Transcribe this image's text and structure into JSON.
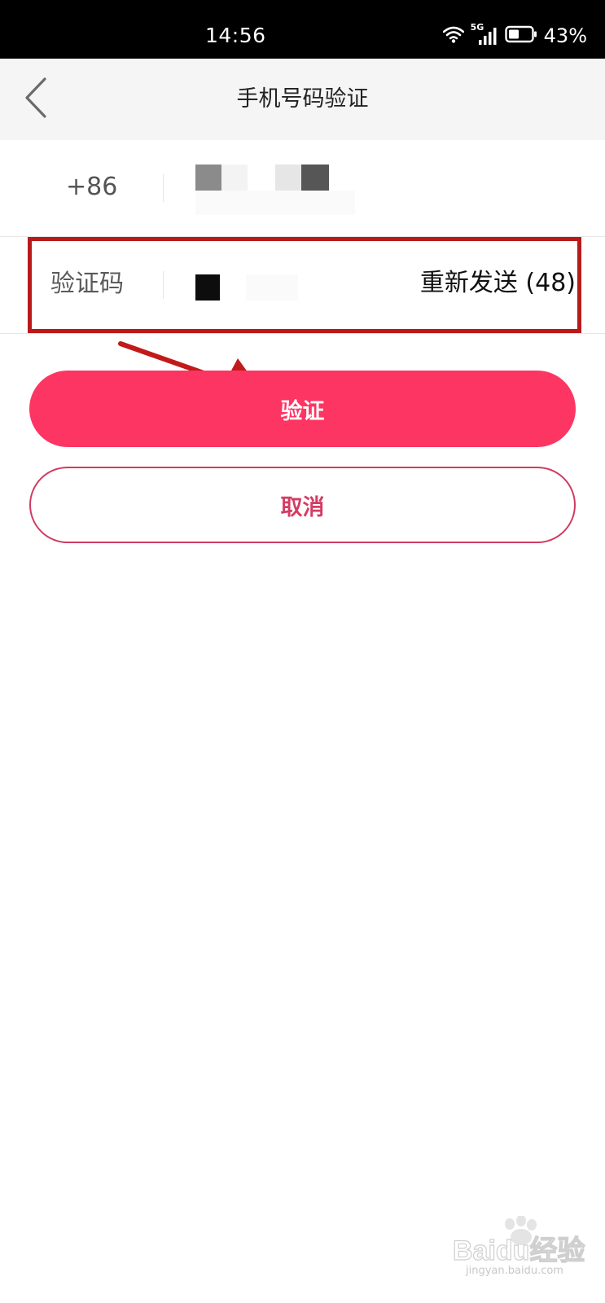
{
  "status_bar": {
    "time": "14:56",
    "network": "5G",
    "battery_percent": "43%",
    "icons": [
      "wifi-icon",
      "signal-icon",
      "battery-icon"
    ]
  },
  "nav": {
    "back_icon": "chevron-left-icon",
    "title": "手机号码验证"
  },
  "form": {
    "phone_prefix": "+86",
    "code_label": "验证码",
    "resend_label": "重新发送 (48)"
  },
  "buttons": {
    "verify_label": "验证",
    "cancel_label": "取消"
  },
  "watermark": {
    "brand": "Baidu经验",
    "domain": "jingyan.baidu.com"
  },
  "colors": {
    "primary": "#fd3562",
    "cancel_text": "#d43c63",
    "annotation": "#b81a1a"
  }
}
